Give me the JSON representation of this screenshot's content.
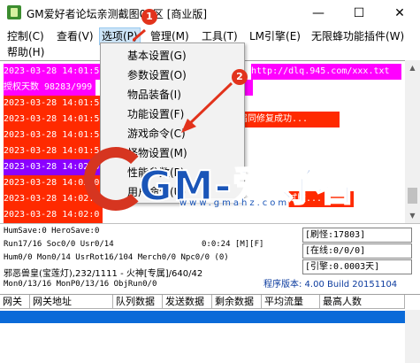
{
  "window": {
    "title": "GM爱好者论坛亲测截图01区 [商业版]",
    "minimize_glyph": "—",
    "maximize_glyph": "☐",
    "close_glyph": "✕"
  },
  "menubar": {
    "items": [
      {
        "label": "控制(C)"
      },
      {
        "label": "查看(V)"
      },
      {
        "label": "选项(P)"
      },
      {
        "label": "管理(M)"
      },
      {
        "label": "工具(T)"
      },
      {
        "label": "LM引擎(E)"
      },
      {
        "label": "无限蜂功能插件(W)"
      },
      {
        "label": "帮助(H)"
      }
    ]
  },
  "dropdown": {
    "items": [
      {
        "label": "基本设置(G)"
      },
      {
        "label": "参数设置(O)"
      },
      {
        "label": "物品装备(I)"
      },
      {
        "label": "功能设置(F)"
      },
      {
        "label": "游戏命令(C)"
      },
      {
        "label": "怪物设置(M)"
      },
      {
        "label": "性能参数(P)"
      },
      {
        "label": "用户命令(U)"
      }
    ]
  },
  "log": {
    "lines": [
      {
        "text": "2023-03-28 14:01:5",
        "bg": "#ff00ff"
      },
      {
        "text": "授权天数 98283/999",
        "bg": "#ff00ff"
      },
      {
        "text": "2023-03-28 14:01:5",
        "bg": "#ff2a00"
      },
      {
        "text": "2023-03-28 14:01:5",
        "bg": "#ff2a00"
      },
      {
        "text": "2023-03-28 14:01:5",
        "bg": "#ff2a00"
      },
      {
        "text": "2023-03-28 14:01:5",
        "bg": "#ff2a00"
      },
      {
        "text": "2023-03-28 14:02:0",
        "bg": "#8b00ff"
      },
      {
        "text": "2023-03-28 14:02:0",
        "bg": "#ff2a00"
      },
      {
        "text": "2023-03-28 14:02:0",
        "bg": "#ff2a00"
      },
      {
        "text": "2023-03-28 14:02:0",
        "bg": "#ff2a00"
      }
    ],
    "right_fragments": [
      {
        "text": "http://dlq.945.com/xxx.txt",
        "bg": "#ff00ff"
      },
      {
        "text": "届同修复成功...",
        "bg": "#ff2a00"
      },
      {
        "text": "试版...",
        "bg": "#ff2a00"
      }
    ]
  },
  "status": {
    "line1": "HumSave:0 HeroSave:0",
    "line2": "Run17/16 Soc0/0 Usr0/14",
    "line2_time": "0:0:24 [M][F]",
    "line3": "Hum0/0 Mon0/14 UsrRot16/104 Merch0/0 Npc0/0 (0)",
    "line4": "邪恶兽皇(宝莲灯),232/1111 - 火神[专属]/640/42",
    "line5": "Mon0/13/16 MonP0/13/16 ObjRun0/0",
    "box1": "[刷怪:17803]",
    "box2": "[在线:0/0/0]",
    "box3": "[引擎:0.0003天]",
    "version": "程序版本: 4.00 Build 20151104"
  },
  "grid": {
    "headers": [
      "网关",
      "网关地址",
      "队列数据",
      "发送数据",
      "剩余数据",
      "平均流量",
      "最高人数"
    ]
  },
  "watermark": {
    "brand": "GM-爱好者",
    "url": "www.gmahz.com"
  },
  "badges": {
    "one": "1",
    "two": "2"
  }
}
